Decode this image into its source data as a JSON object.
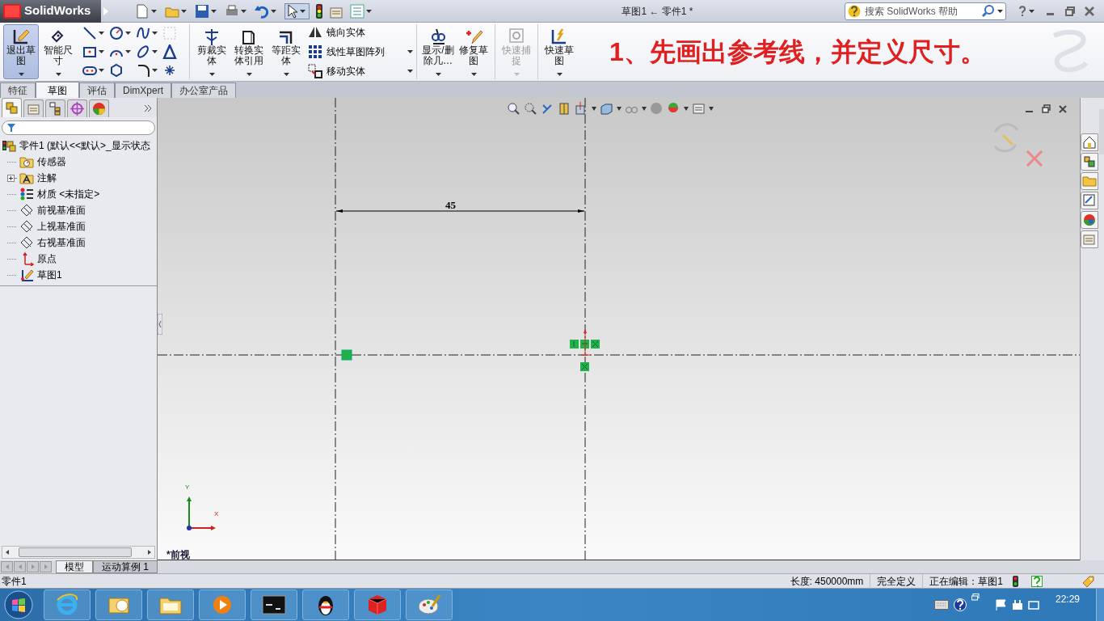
{
  "title_bar": {
    "logo": "SolidWorks",
    "title": "草图1 ← 零件1 *",
    "search": {
      "placeholder": "搜索 SolidWorks 帮助"
    }
  },
  "ribbon": {
    "left_buttons": [
      {
        "label": "退出草图",
        "selected": true,
        "kind": "exit"
      },
      {
        "label": "智能尺寸",
        "selected": false,
        "kind": "dim"
      }
    ],
    "edit_buttons": [
      {
        "label": "剪裁实体",
        "kind": "trim"
      },
      {
        "label": "转换实体引用",
        "kind": "convert"
      },
      {
        "label": "等距实体",
        "kind": "offset"
      }
    ],
    "list_items": [
      {
        "label": "镜向实体",
        "kind": "mirror"
      },
      {
        "label": "线性草图阵列",
        "kind": "pattern"
      },
      {
        "label": "移动实体",
        "kind": "move"
      }
    ],
    "right_buttons": [
      {
        "label": "显示/删除几…",
        "disabled": false,
        "kind": "relations"
      },
      {
        "label": "修复草图",
        "disabled": false,
        "kind": "repair"
      },
      {
        "label": "快速捕捉",
        "disabled": true,
        "kind": "snap"
      },
      {
        "label": "快速草图",
        "disabled": false,
        "kind": "rapid"
      }
    ],
    "annotation": "1、先画出参考线，并定义尺寸。"
  },
  "command_tabs": [
    {
      "label": "特征",
      "selected": false
    },
    {
      "label": "草图",
      "selected": true
    },
    {
      "label": "评估",
      "selected": false
    },
    {
      "label": "DimXpert",
      "selected": false
    },
    {
      "label": "办公室产品",
      "selected": false
    }
  ],
  "feature_tree": {
    "root": {
      "label": "零件1  (默认<<默认>_显示状态",
      "children": [
        {
          "label": "传感器",
          "kind": "sensor"
        },
        {
          "label": "注解",
          "kind": "annotation",
          "expanded": false
        },
        {
          "label": "材质 <未指定>",
          "kind": "material"
        },
        {
          "label": "前视基准面",
          "kind": "plane"
        },
        {
          "label": "上视基准面",
          "kind": "plane"
        },
        {
          "label": "右视基准面",
          "kind": "plane"
        },
        {
          "label": "原点",
          "kind": "origin"
        },
        {
          "label": "草图1",
          "kind": "sketch"
        }
      ]
    },
    "panel_tabs": [
      {
        "selected": true
      },
      {
        "selected": false
      },
      {
        "selected": false
      },
      {
        "selected": false
      },
      {
        "selected": false
      }
    ]
  },
  "graphics": {
    "dimension": "45",
    "view_label": "*前视",
    "axis_x": "X",
    "axis_y": "Y"
  },
  "bottom_tabs": [
    {
      "label": "模型",
      "selected": true
    },
    {
      "label": "运动算例 1",
      "selected": false
    }
  ],
  "status_bar": {
    "document": "零件1",
    "fields": [
      "长度: 450000mm",
      "完全定义",
      "正在编辑：草图1"
    ]
  },
  "taskbar": {
    "clock": "22:29"
  }
}
